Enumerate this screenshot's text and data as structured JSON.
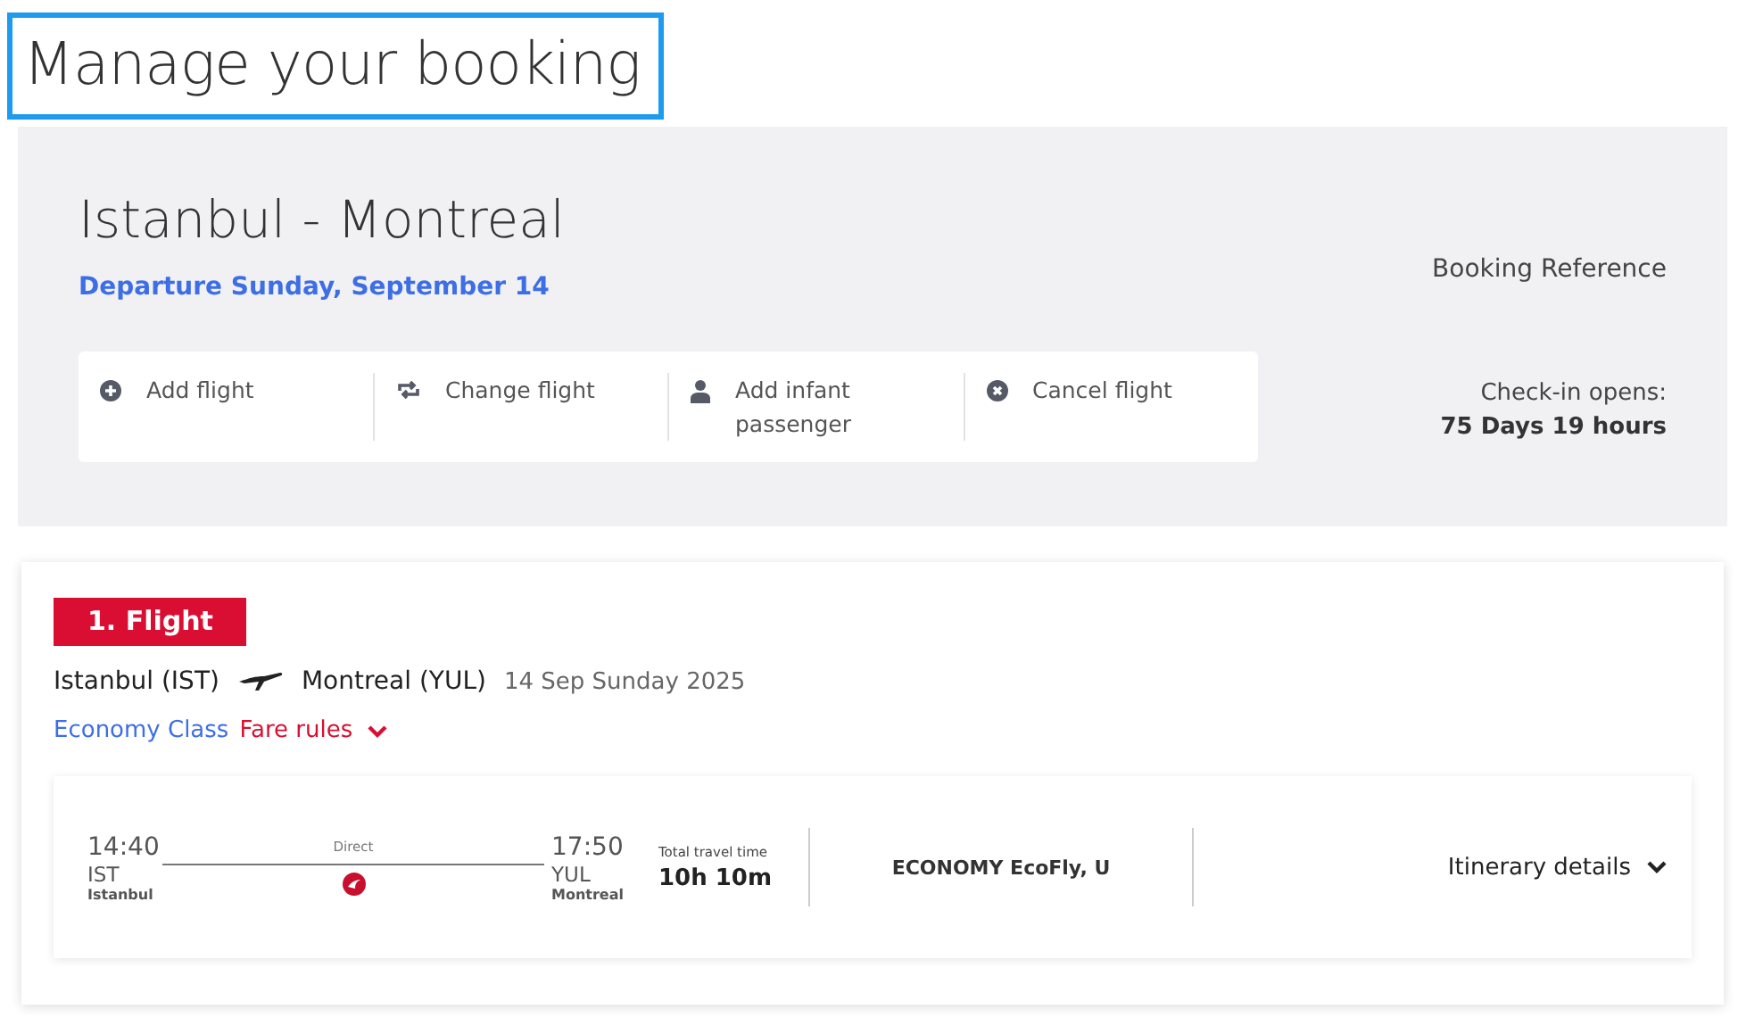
{
  "page_title": "Manage your booking",
  "summary": {
    "route": "Istanbul - Montreal",
    "departure": "Departure Sunday, September 14",
    "booking_reference_label": "Booking Reference",
    "checkin_label": "Check-in opens:",
    "checkin_value": "75 Days 19 hours",
    "actions": [
      {
        "kind": "add",
        "label": "Add flight"
      },
      {
        "kind": "change",
        "label": "Change flight"
      },
      {
        "kind": "infant",
        "label": "Add infant passenger"
      },
      {
        "kind": "cancel",
        "label": "Cancel flight"
      }
    ]
  },
  "flight": {
    "badge": "1. Flight",
    "origin": "Istanbul (IST)",
    "destination": "Montreal (YUL)",
    "date": "14 Sep Sunday 2025",
    "cabin": "Economy Class",
    "fare_rules": "Fare rules",
    "segment": {
      "dep_time": "14:40",
      "dep_code": "IST",
      "dep_city": "Istanbul",
      "stops": "Direct",
      "arr_time": "17:50",
      "arr_code": "YUL",
      "arr_city": "Montreal",
      "travel_time_label": "Total travel time",
      "travel_time": "10h 10m",
      "fare": "ECONOMY EcoFly, U",
      "details": "Itinerary details"
    }
  }
}
